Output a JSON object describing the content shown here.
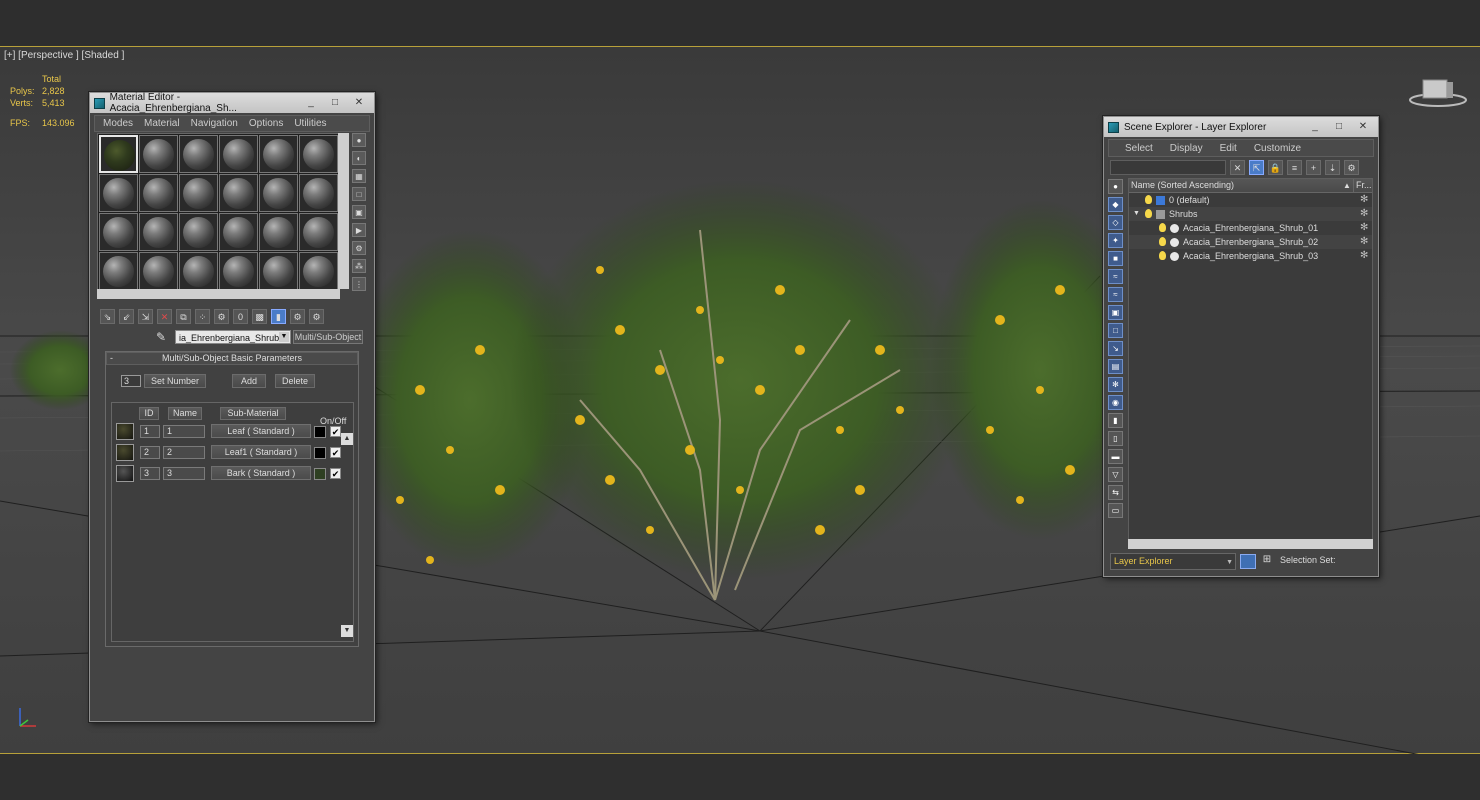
{
  "viewport": {
    "label": "[+] [Perspective ] [Shaded ]",
    "stats": {
      "total_label": "Total",
      "polys_label": "Polys:",
      "polys_value": "2,828",
      "verts_label": "Verts:",
      "verts_value": "5,413",
      "fps_label": "FPS:",
      "fps_value": "143.096"
    },
    "stats_color": "#e8c64a",
    "border_color": "#b8a13a"
  },
  "material_editor": {
    "title": "Material Editor - Acacia_Ehrenbergiana_Sh...",
    "window_buttons": [
      "_",
      "□",
      "✕"
    ],
    "menu": [
      "Modes",
      "Material",
      "Navigation",
      "Options",
      "Utilities"
    ],
    "material_name": "ia_Ehrenbergiana_Shrubs",
    "material_type": "Multi/Sub-Object",
    "rollout_title": "Multi/Sub-Object Basic Parameters",
    "set_number_value": "3",
    "buttons": {
      "set_number": "Set Number",
      "add": "Add",
      "delete": "Delete"
    },
    "headers": {
      "id": "ID",
      "name": "Name",
      "sub_material": "Sub-Material",
      "on_off": "On/Off"
    },
    "rows": [
      {
        "id": "1",
        "name": "1",
        "sub_material": "Leaf  ( Standard )",
        "swatch": "#000000",
        "on": "✔"
      },
      {
        "id": "2",
        "name": "2",
        "sub_material": "Leaf1  ( Standard )",
        "swatch": "#000000",
        "on": "✔"
      },
      {
        "id": "3",
        "name": "3",
        "sub_material": "Bark  ( Standard )",
        "swatch": "#2e3f22",
        "on": "✔"
      }
    ]
  },
  "scene_explorer": {
    "title": "Scene Explorer - Layer Explorer",
    "window_buttons": [
      "_",
      "□",
      "✕"
    ],
    "menu": [
      "Select",
      "Display",
      "Edit",
      "Customize"
    ],
    "column_name": "Name (Sorted Ascending)",
    "column_frozen": "Fr...",
    "tree": [
      {
        "label": "0 (default)",
        "level": 1,
        "type": "layer"
      },
      {
        "label": "Shrubs",
        "level": 1,
        "type": "layer-group"
      },
      {
        "label": "Acacia_Ehrenbergiana_Shrub_01",
        "level": 2,
        "type": "object"
      },
      {
        "label": "Acacia_Ehrenbergiana_Shrub_02",
        "level": 2,
        "type": "object"
      },
      {
        "label": "Acacia_Ehrenbergiana_Shrub_03",
        "level": 2,
        "type": "object"
      }
    ],
    "explorer_select": "Layer Explorer",
    "selection_set_label": "Selection Set:"
  }
}
